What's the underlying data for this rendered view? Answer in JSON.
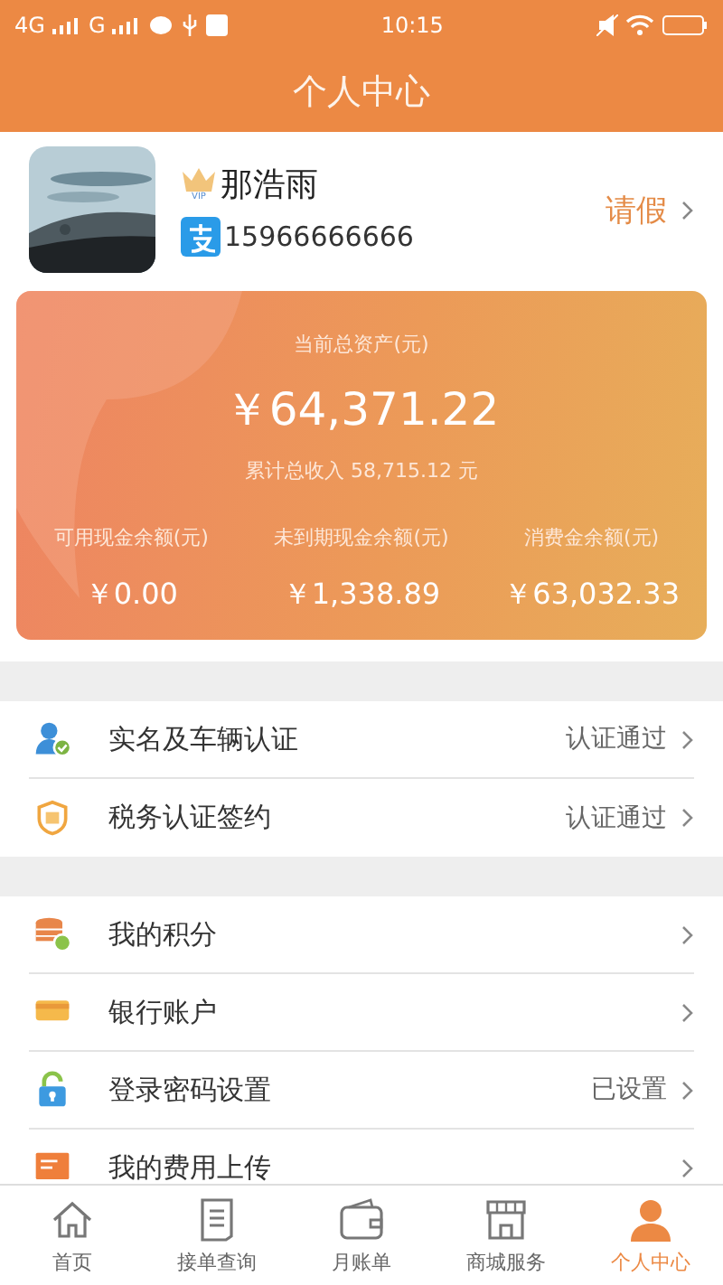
{
  "status_bar": {
    "network_1": "4G",
    "network_2": "G",
    "time": "10:15"
  },
  "header": {
    "title": "个人中心"
  },
  "profile": {
    "badge": "VIP",
    "name": "那浩雨",
    "phone": "15966666666",
    "leave_link": "请假"
  },
  "assets": {
    "total_label": "当前总资产(元)",
    "total_value": "￥64,371.22",
    "income": "累计总收入 58,715.12 元",
    "balances": [
      {
        "label": "可用现金余额(元)",
        "value": "￥0.00"
      },
      {
        "label": "未到期现金余额(元)",
        "value": "￥1,338.89"
      },
      {
        "label": "消费金余额(元)",
        "value": "￥63,032.33"
      }
    ]
  },
  "groups": [
    {
      "items": [
        {
          "label": "实名及车辆认证",
          "status": "认证通过"
        },
        {
          "label": "税务认证签约",
          "status": "认证通过"
        }
      ]
    },
    {
      "items": [
        {
          "label": "我的积分"
        },
        {
          "label": "银行账户"
        },
        {
          "label": "登录密码设置",
          "status": "已设置"
        },
        {
          "label": "我的费用上传"
        }
      ]
    }
  ],
  "tabs": [
    {
      "label": "首页",
      "selected": false
    },
    {
      "label": "接单查询",
      "selected": false
    },
    {
      "label": "月账单",
      "selected": false
    },
    {
      "label": "商城服务",
      "selected": false
    },
    {
      "label": "个人中心",
      "selected": true
    }
  ]
}
